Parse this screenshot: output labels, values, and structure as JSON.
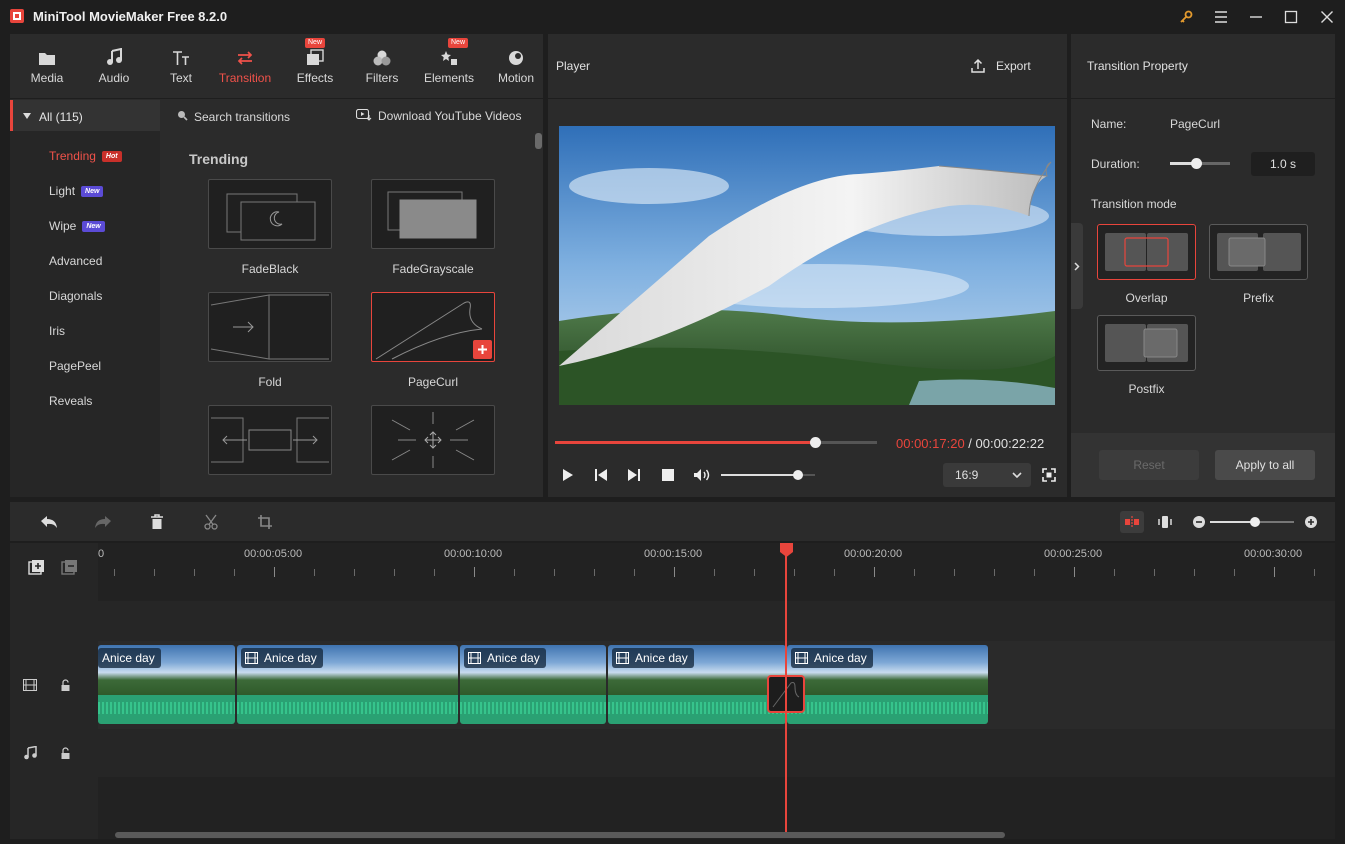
{
  "app": {
    "title": "MiniTool MovieMaker Free 8.2.0"
  },
  "toolbar": {
    "tabs": [
      {
        "label": "Media",
        "icon": "folder-icon"
      },
      {
        "label": "Audio",
        "icon": "music-note-icon"
      },
      {
        "label": "Text",
        "icon": "text-icon"
      },
      {
        "label": "Transition",
        "icon": "transition-arrows-icon",
        "active": true
      },
      {
        "label": "Effects",
        "icon": "effects-icon",
        "badge": "New"
      },
      {
        "label": "Filters",
        "icon": "filters-icon"
      },
      {
        "label": "Elements",
        "icon": "elements-icon",
        "badge": "New"
      },
      {
        "label": "Motion",
        "icon": "motion-icon"
      }
    ]
  },
  "categories": {
    "all_label": "All (115)",
    "items": [
      {
        "label": "Trending",
        "badge": "Hot",
        "active": true
      },
      {
        "label": "Light",
        "badge": "New"
      },
      {
        "label": "Wipe",
        "badge": "New"
      },
      {
        "label": "Advanced"
      },
      {
        "label": "Diagonals"
      },
      {
        "label": "Iris"
      },
      {
        "label": "PagePeel"
      },
      {
        "label": "Reveals"
      }
    ]
  },
  "library": {
    "search_placeholder": "Search transitions",
    "download_label": "Download YouTube Videos",
    "section_title": "Trending",
    "items": [
      {
        "label": "FadeBlack"
      },
      {
        "label": "FadeGrayscale"
      },
      {
        "label": "Fold"
      },
      {
        "label": "PageCurl",
        "selected": true
      }
    ]
  },
  "player": {
    "title": "Player",
    "export_label": "Export",
    "current_time": "00:00:17:20",
    "separator": " / ",
    "total_time": "00:00:22:22",
    "aspect_ratio": "16:9",
    "progress_fraction": 0.81,
    "volume_fraction": 0.82
  },
  "property": {
    "title": "Transition Property",
    "name_label": "Name:",
    "name_value": "PageCurl",
    "duration_label": "Duration:",
    "duration_value": "1.0 s",
    "duration_fraction": 0.45,
    "mode_label": "Transition mode",
    "modes": [
      {
        "label": "Overlap",
        "selected": true
      },
      {
        "label": "Prefix"
      },
      {
        "label": "Postfix"
      }
    ],
    "reset_label": "Reset",
    "apply_all_label": "Apply to all"
  },
  "timeline": {
    "zoom_fraction": 0.53,
    "ruler_labels": [
      "0",
      "00:00:05:00",
      "00:00:10:00",
      "00:00:15:00",
      "00:00:20:00",
      "00:00:25:00",
      "00:00:30:00"
    ],
    "clips": [
      {
        "label": "Anice day"
      },
      {
        "label": "Anice day"
      },
      {
        "label": "Anice day"
      },
      {
        "label": "Anice day"
      },
      {
        "label": "Anice day"
      }
    ]
  },
  "colors": {
    "accent": "#e8453c",
    "panel": "#2b2b2b",
    "background": "#1e1e1e",
    "audio_wave": "#2aa173"
  }
}
